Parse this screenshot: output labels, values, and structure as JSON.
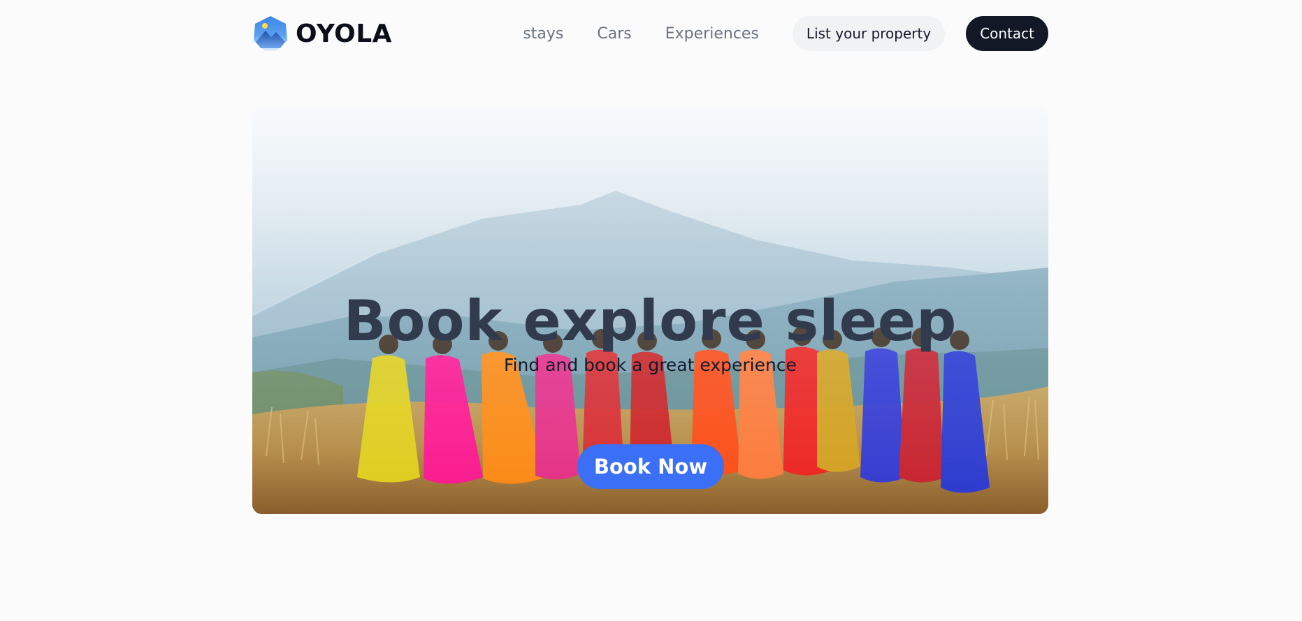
{
  "brand": {
    "name": "OYOLA",
    "logo_icon": "mountain-sun-hexagon-icon"
  },
  "nav": {
    "links": [
      "stays",
      "Cars",
      "Experiences"
    ],
    "list_property_label": "List your property",
    "contact_label": "Contact"
  },
  "hero": {
    "title": "Book explore sleep",
    "subtitle": "Find and book a great experience",
    "cta_label": "Book Now",
    "image_subject": "women-in-colorful-saris-dancing-in-field-photo"
  },
  "colors": {
    "background": "#fbfbfb",
    "contact_button": "#121826",
    "cta_button": "#3b6ff5",
    "title_text": "#323b4e"
  }
}
